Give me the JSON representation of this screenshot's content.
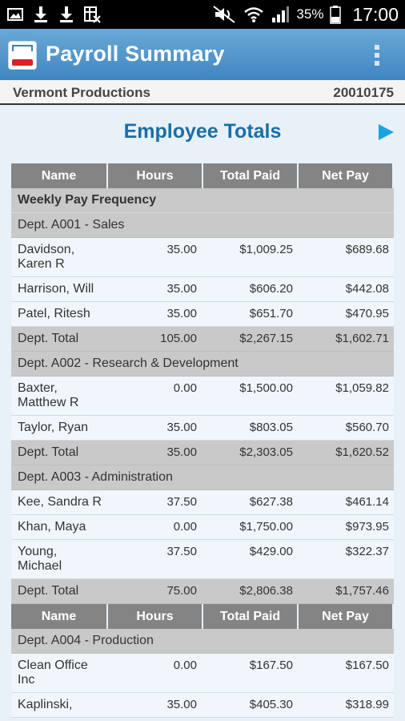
{
  "status_bar": {
    "battery_percent": "35%",
    "time": "17:00",
    "left_icons": [
      "image-icon",
      "download-icon",
      "download-icon",
      "spreadsheet-icon"
    ],
    "right_icons": [
      "mute-icon",
      "wifi-icon",
      "signal-icon",
      "battery-icon"
    ]
  },
  "app_bar": {
    "title": "Payroll Summary",
    "logo_icon": "adp-logo-icon",
    "overflow_icon": "overflow-menu-icon"
  },
  "company": {
    "name": "Vermont Productions",
    "id": "20010175"
  },
  "section": {
    "title": "Employee Totals",
    "next_icon": "play-arrow-icon"
  },
  "table": {
    "headers": [
      "Name",
      "Hours",
      "Total Paid",
      "Net Pay"
    ],
    "frequency": "Weekly Pay Frequency",
    "departments": [
      {
        "title": "Dept. A001 - Sales",
        "employees": [
          {
            "name_line1": "Davidson,",
            "name_line2": "Karen R",
            "hours": "35.00",
            "paid": "$1,009.25",
            "net": "$689.68"
          },
          {
            "name_line1": "Harrison, Will",
            "name_line2": "",
            "hours": "35.00",
            "paid": "$606.20",
            "net": "$442.08"
          },
          {
            "name_line1": "Patel, Ritesh",
            "name_line2": "",
            "hours": "35.00",
            "paid": "$651.70",
            "net": "$470.95"
          }
        ],
        "total": {
          "label": "Dept. Total",
          "hours": "105.00",
          "paid": "$2,267.15",
          "net": "$1,602.71"
        }
      },
      {
        "title": "Dept. A002 - Research & Development",
        "employees": [
          {
            "name_line1": "Baxter,",
            "name_line2": "Matthew R",
            "hours": "0.00",
            "paid": "$1,500.00",
            "net": "$1,059.82"
          },
          {
            "name_line1": "Taylor, Ryan",
            "name_line2": "",
            "hours": "35.00",
            "paid": "$803.05",
            "net": "$560.70"
          }
        ],
        "total": {
          "label": "Dept. Total",
          "hours": "35.00",
          "paid": "$2,303.05",
          "net": "$1,620.52"
        }
      },
      {
        "title": "Dept. A003 - Administration",
        "employees": [
          {
            "name_line1": "Kee, Sandra R",
            "name_line2": "",
            "hours": "37.50",
            "paid": "$627.38",
            "net": "$461.14"
          },
          {
            "name_line1": "Khan, Maya",
            "name_line2": "",
            "hours": "0.00",
            "paid": "$1,750.00",
            "net": "$973.95"
          },
          {
            "name_line1": "Young,",
            "name_line2": "Michael",
            "hours": "37.50",
            "paid": "$429.00",
            "net": "$322.37"
          }
        ],
        "total": {
          "label": "Dept. Total",
          "hours": "75.00",
          "paid": "$2,806.38",
          "net": "$1,757.46"
        }
      },
      {
        "title": "Dept. A004 - Production",
        "employees": [
          {
            "name_line1": "Clean Office",
            "name_line2": "Inc",
            "hours": "0.00",
            "paid": "$167.50",
            "net": "$167.50"
          },
          {
            "name_line1": "Kaplinski,",
            "name_line2": "",
            "hours": "35.00",
            "paid": "$405.30",
            "net": "$318.99"
          }
        ]
      }
    ]
  }
}
